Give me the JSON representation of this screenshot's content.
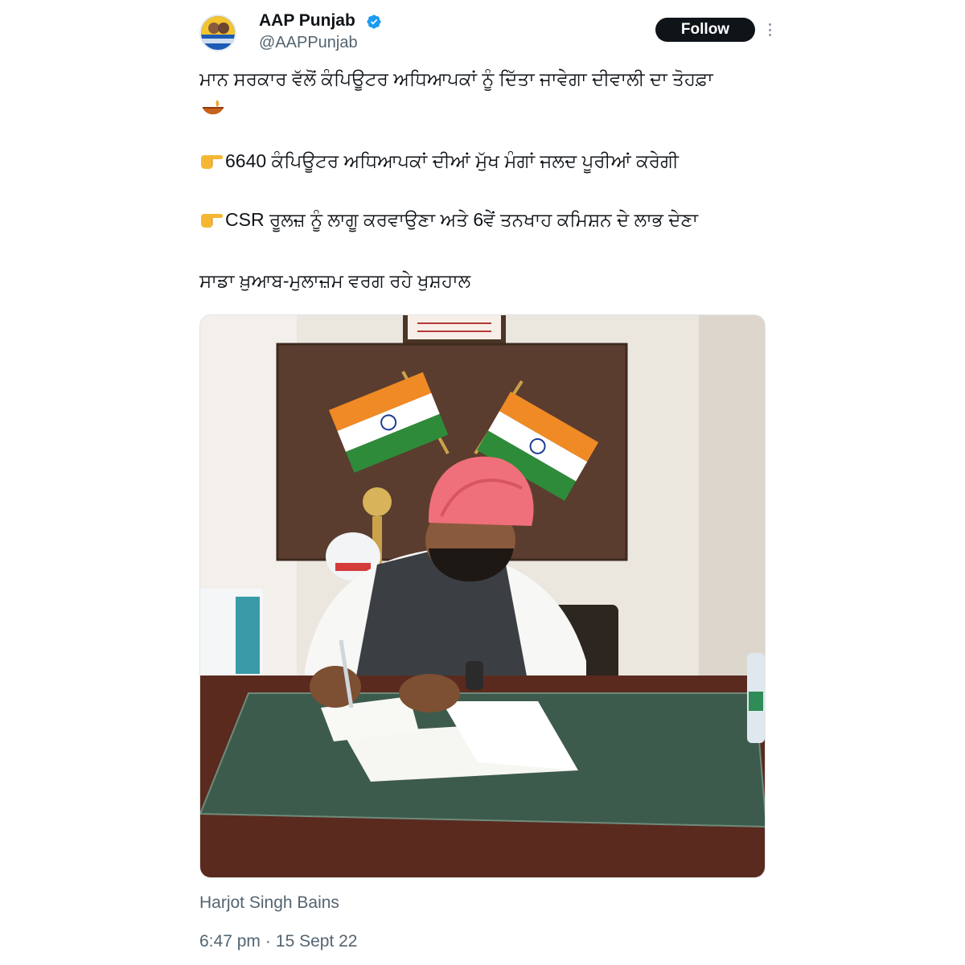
{
  "account": {
    "display_name": "AAP Punjab",
    "handle": "@AAPPunjab",
    "verified": true,
    "avatar_icon": "aap-logo-avatar"
  },
  "actions": {
    "follow_label": "Follow",
    "more_icon": "more-options-icon"
  },
  "tweet": {
    "line1": "ਮਾਨ ਸਰਕਾਰ ਵੱਲੋਂ ਕੰਪਿਊਟਰ ਅਧਿਆਪਕਾਂ ਨੂੰ ਦਿੱਤਾ ਜਾਵੇਗਾ ਦੀਵਾਲੀ ਦਾ ਤੋਹਫ਼ਾ",
    "line1_emoji": "diya-lamp-icon",
    "line2": "6640 ਕੰਪਿਊਟਰ ਅਧਿਆਪਕਾਂ ਦੀਆਂ ਮੁੱਖ ਮੰਗਾਂ ਜਲਦ ਪੂਰੀਆਂ ਕਰੇਗੀ",
    "line3": "CSR ਰੂਲਜ਼ ਨੂੰ ਲਾਗੂ ਕਰਵਾਉਣਾ ਅਤੇ 6ਵੇਂ ਤਨਖਾਹ ਕਮਿਸ਼ਨ ਦੇ ਲਾਭ ਦੇਣਾ",
    "line4": "ਸਾਡਾ ਖ਼ੁਆਬ-ਮੁਲਾਜ਼ਮ ਵਰਗ ਰਹੇ ਖੁਸ਼ਹਾਲ",
    "bullet_icon": "pointing-hand-icon"
  },
  "media": {
    "caption": "Harjot Singh Bains"
  },
  "meta": {
    "time": "6:47 pm",
    "separator": "·",
    "date": "15 Sept 22"
  },
  "colors": {
    "text_primary": "#0f1419",
    "text_secondary": "#536471",
    "verified_blue": "#1d9bf0",
    "follow_bg": "#0f1419"
  }
}
